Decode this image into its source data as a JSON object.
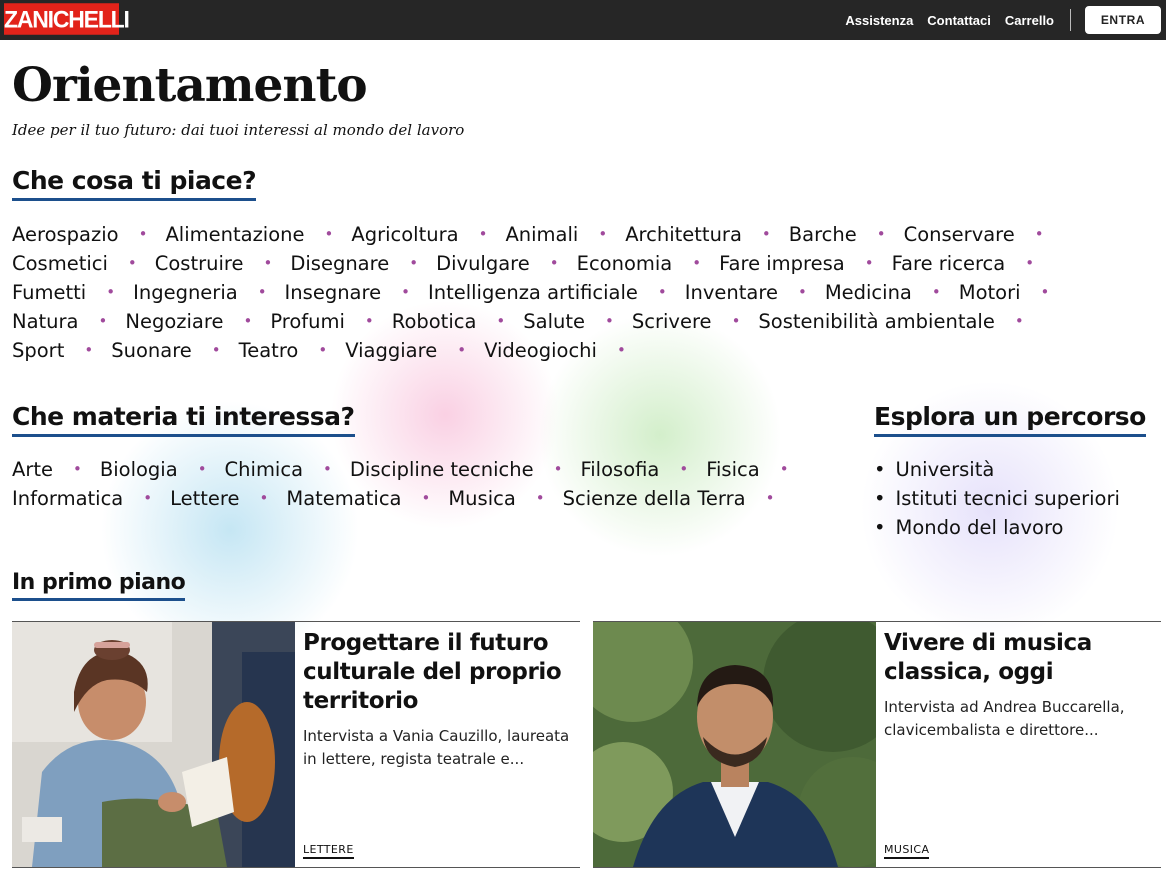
{
  "header": {
    "logo": "ZANICHELLI",
    "nav": [
      "Assistenza",
      "Contattaci",
      "Carrello"
    ],
    "login_label": "ENTRA"
  },
  "page": {
    "title": "Orientamento",
    "subtitle": "Idee per il tuo futuro: dai tuoi interessi al mondo del lavoro"
  },
  "interests": {
    "title": "Che cosa ti piace?",
    "items": [
      "Aerospazio",
      "Alimentazione",
      "Agricoltura",
      "Animali",
      "Architettura",
      "Barche",
      "Conservare",
      "Cosmetici",
      "Costruire",
      "Disegnare",
      "Divulgare",
      "Economia",
      "Fare impresa",
      "Fare ricerca",
      "Fumetti",
      "Ingegneria",
      "Insegnare",
      "Intelligenza artificiale",
      "Inventare",
      "Medicina",
      "Motori",
      "Natura",
      "Negoziare",
      "Profumi",
      "Robotica",
      "Salute",
      "Scrivere",
      "Sostenibilità ambientale",
      "Sport",
      "Suonare",
      "Teatro",
      "Viaggiare",
      "Videogiochi"
    ]
  },
  "subjects": {
    "title": "Che materia ti interessa?",
    "items": [
      "Arte",
      "Biologia",
      "Chimica",
      "Discipline tecniche",
      "Filosofia",
      "Fisica",
      "Informatica",
      "Lettere",
      "Matematica",
      "Musica",
      "Scienze della Terra"
    ]
  },
  "paths": {
    "title": "Esplora un percorso",
    "items": [
      "Università",
      "Istituti tecnici superiori",
      "Mondo del lavoro"
    ]
  },
  "featured": {
    "title": "In primo piano",
    "cards": [
      {
        "title": "Progettare il futuro culturale del proprio territorio",
        "text": "Intervista a Vania Cauzillo, laureata in lettere, regista teatrale e...",
        "tag": "LETTERE"
      },
      {
        "title": "Vivere di musica classica, oggi",
        "text": "Intervista ad Andrea Buccarella, clavicembalista e direttore...",
        "tag": "MUSICA"
      }
    ]
  },
  "colors": {
    "topbar": "#262626",
    "logo_red": "#e2231a",
    "underline_blue": "#1c4f8c",
    "bullet_purple": "#a04a9c"
  }
}
